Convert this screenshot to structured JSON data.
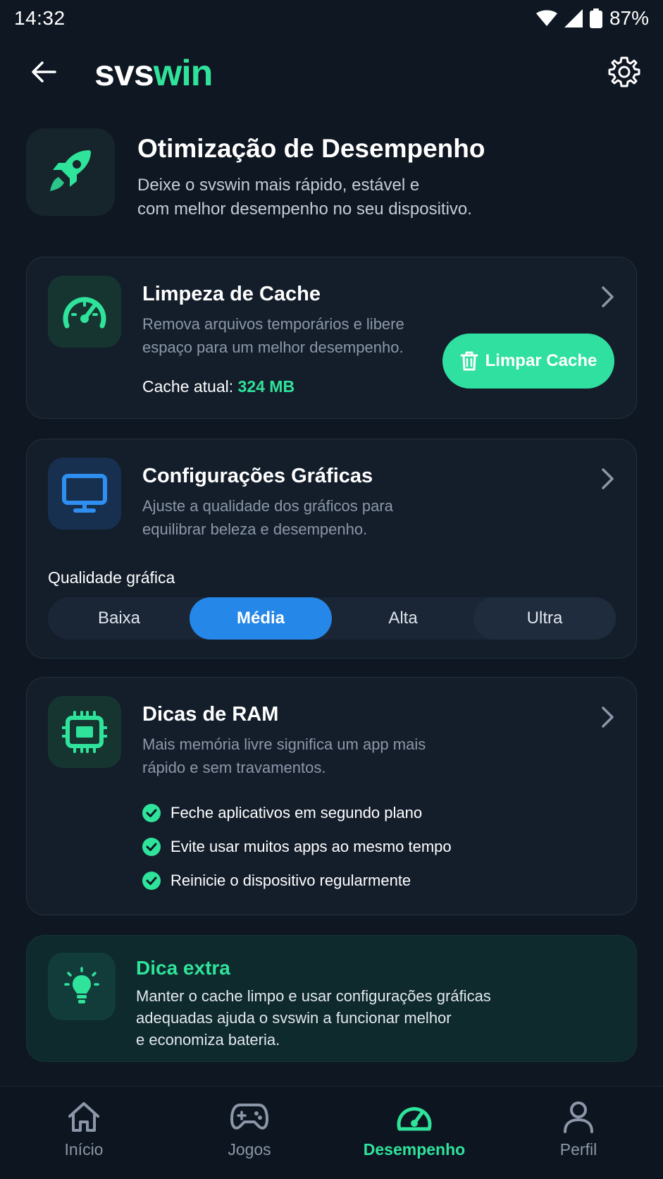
{
  "status_bar": {
    "time": "14:32",
    "battery": "87%"
  },
  "header": {
    "logo_part1": "svs",
    "logo_part2": "win"
  },
  "hero": {
    "title": "Otimização de Desempenho",
    "subtitle_line1": "Deixe o svswin mais rápido, estável e",
    "subtitle_line2": "com melhor desempenho no seu dispositivo."
  },
  "cache_card": {
    "title": "Limpeza de Cache",
    "desc_line1": "Remova arquivos temporários e libere",
    "desc_line2": "espaço para um melhor desempenho.",
    "current_label": "Cache atual:",
    "current_value": "324 MB",
    "button_label": "Limpar Cache"
  },
  "graphics_card": {
    "title": "Configurações Gráficas",
    "desc_line1": "Ajuste a qualidade dos gráficos para",
    "desc_line2": "equilibrar beleza e desempenho.",
    "quality_label": "Qualidade gráfica",
    "options": [
      "Baixa",
      "Média",
      "Alta",
      "Ultra"
    ],
    "selected": "Média"
  },
  "ram_card": {
    "title": "Dicas de RAM",
    "desc_line1": "Mais memória livre significa um app mais",
    "desc_line2": "rápido e sem travamentos.",
    "tips": [
      "Feche aplicativos em segundo plano",
      "Evite usar muitos apps ao mesmo tempo",
      "Reinicie o dispositivo regularmente"
    ]
  },
  "extra_card": {
    "title": "Dica extra",
    "desc_line1": "Manter o cache limpo e usar configurações gráficas",
    "desc_line2": "adequadas ajuda o svswin a funcionar melhor",
    "desc_line3": "e economiza bateria."
  },
  "bottom_nav": {
    "items": [
      {
        "label": "Início",
        "icon": "home-icon"
      },
      {
        "label": "Jogos",
        "icon": "gamepad-icon"
      },
      {
        "label": "Desempenho",
        "icon": "speedometer-icon"
      },
      {
        "label": "Perfil",
        "icon": "user-icon"
      }
    ],
    "active": "Desempenho"
  },
  "colors": {
    "background": "#0f1722",
    "accent_green": "#2fe39b",
    "accent_blue": "#2587e8",
    "card_bg": "#141e2b"
  }
}
